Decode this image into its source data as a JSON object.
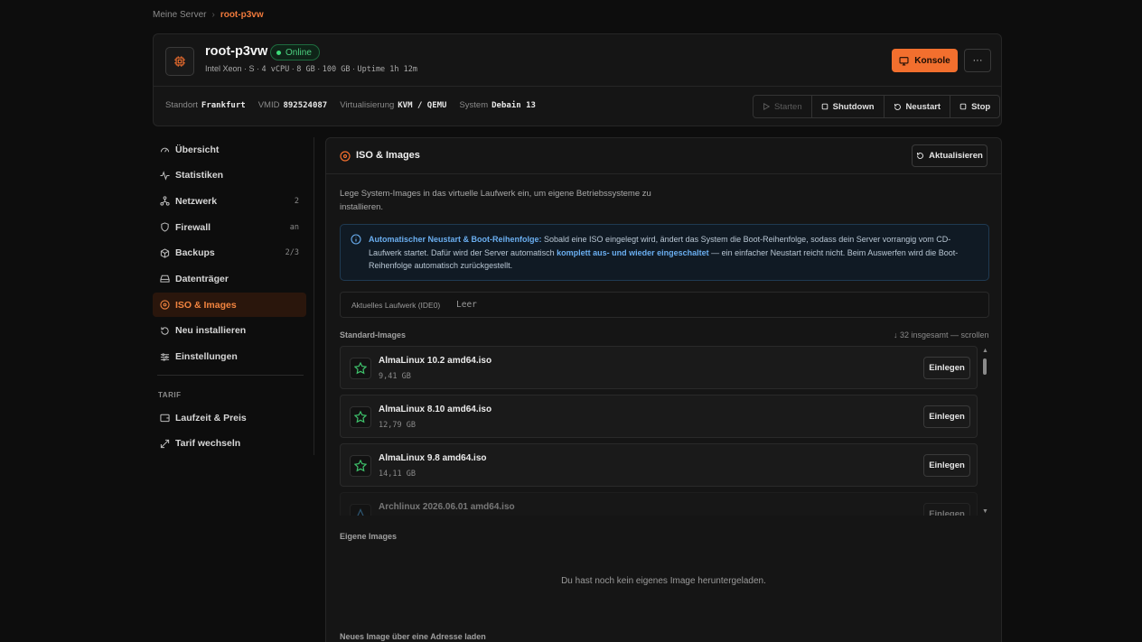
{
  "breadcrumb": {
    "parent": "Meine Server",
    "separator": "›",
    "current": "root-p3vw"
  },
  "server": {
    "name": "root-p3vw",
    "status": "Online",
    "cpu": "Intel Xeon · S",
    "vcpu": "4 vCPU",
    "ram": "8 GB",
    "disk": "100 GB",
    "uptime": "Uptime 1h 12m",
    "console_label": "Konsole",
    "more_label": "···"
  },
  "meta": {
    "location_label": "Standort",
    "location": "Frankfurt",
    "vmid_label": "VMID",
    "vmid": "892524087",
    "virt_label": "Virtualisierung",
    "virt": "KVM / QEMU",
    "os_label": "System",
    "os": "Debain 13"
  },
  "power": {
    "start": "Starten",
    "shutdown": "Shutdown",
    "restart": "Neustart",
    "stop": "Stop"
  },
  "sidebar": {
    "items": [
      {
        "label": "Übersicht",
        "icon": "gauge-icon",
        "count": ""
      },
      {
        "label": "Statistiken",
        "icon": "activity-icon",
        "count": ""
      },
      {
        "label": "Netzwerk",
        "icon": "network-icon",
        "count": "2"
      },
      {
        "label": "Firewall",
        "icon": "shield-icon",
        "count": "an"
      },
      {
        "label": "Backups",
        "icon": "package-icon",
        "count": "2/3"
      },
      {
        "label": "Datenträger",
        "icon": "drive-icon",
        "count": ""
      },
      {
        "label": "ISO & Images",
        "icon": "disc-icon",
        "count": ""
      },
      {
        "label": "Neu installieren",
        "icon": "rotate-icon",
        "count": ""
      },
      {
        "label": "Einstellungen",
        "icon": "sliders-icon",
        "count": ""
      }
    ],
    "tarif_heading": "TARIF",
    "tarif_items": [
      {
        "label": "Laufzeit & Preis",
        "icon": "wallet-icon"
      },
      {
        "label": "Tarif wechseln",
        "icon": "switch-icon"
      }
    ]
  },
  "panel": {
    "title": "ISO & Images",
    "refresh_label": "Aktualisieren",
    "description": "Lege System-Images in das virtuelle Laufwerk ein, um eigene Betriebssysteme zu installieren.",
    "info_bold": "Automatischer Neustart & Boot-Reihenfolge:",
    "info_text_1": " Sobald eine ISO eingelegt wird, ändert das System die Boot-Reihenfolge, sodass dein Server vorrangig vom CD-Laufwerk startet. Dafür wird der Server automatisch ",
    "info_bold_2": "komplett aus- und wieder eingeschaltet",
    "info_text_2": " — ein einfacher Neustart reicht nicht. Beim Auswerfen wird die Boot-Reihenfolge automatisch zurückgestellt.",
    "drive_label": "Aktuelles Laufwerk (IDE0)",
    "drive_value": "Leer",
    "standard_label": "Standard-Images",
    "standard_count": "↓ 32 insgesamt — scrollen",
    "insert_label": "Einlegen",
    "images": [
      {
        "name": "AlmaLinux 10.2 amd64.iso",
        "size": "9,41 GB"
      },
      {
        "name": "AlmaLinux 8.10 amd64.iso",
        "size": "12,79 GB"
      },
      {
        "name": "AlmaLinux 9.8 amd64.iso",
        "size": "14,11 GB"
      },
      {
        "name": "Archlinux 2026.06.01 amd64.iso",
        "size": ""
      }
    ],
    "own_label": "Eigene Images",
    "own_empty": "Du hast noch kein eigenes Image heruntergeladen.",
    "url_label": "Neues Image über eine Adresse laden"
  },
  "colors": {
    "accent": "#f26f2e",
    "online": "#3ddc7a",
    "info": "#6aaef0"
  }
}
